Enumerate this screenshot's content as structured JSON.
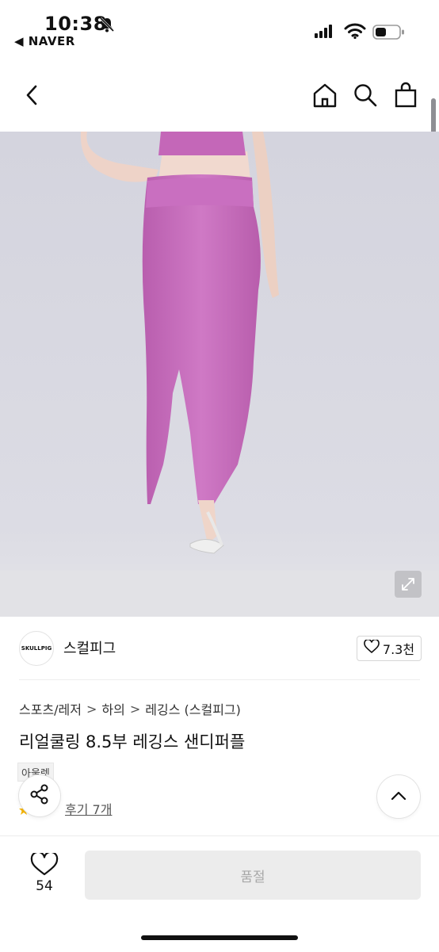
{
  "status_bar": {
    "time": "10:38",
    "back_app": "◀ NAVER"
  },
  "nav": {
    "icons": [
      "back-icon",
      "home-icon",
      "search-icon",
      "shopping-bag-icon"
    ]
  },
  "seller": {
    "logo_text": "SKULLPIG",
    "name": "스컬피그",
    "like_count": "7.3천"
  },
  "breadcrumb": {
    "items": [
      "스포츠/레저",
      "하의",
      "레깅스 (스컬피그)"
    ],
    "separator": ">"
  },
  "product": {
    "title": "리얼쿨링 8.5부 레깅스 샌디퍼플",
    "badge": "아울렛",
    "review_link": "후기 7개"
  },
  "bottom_bar": {
    "wish_count": "54",
    "buy_label": "품절"
  },
  "colors": {
    "leggings": "#c96fc0",
    "background_photo": "#d9d9e3",
    "buy_button_bg": "#ececec",
    "buy_button_text": "#a8a8a8"
  }
}
